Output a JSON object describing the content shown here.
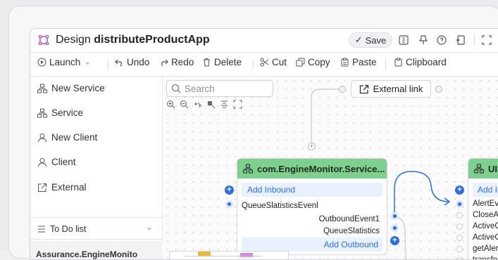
{
  "app": {
    "title_prefix": "Design",
    "title_name": "distributeProductApp",
    "save_label": "Save"
  },
  "toolbar": {
    "launch": "Launch",
    "undo": "Undo",
    "redo": "Redo",
    "delete": "Delete",
    "cut": "Cut",
    "copy": "Copy",
    "paste": "Paste",
    "clipboard": "Clipboard"
  },
  "sidebar": {
    "items": [
      {
        "label": "New Service",
        "icon": "service-icon"
      },
      {
        "label": "Service",
        "icon": "service-icon"
      },
      {
        "label": "New Client",
        "icon": "user-icon"
      },
      {
        "label": "Client",
        "icon": "user-icon"
      },
      {
        "label": "External",
        "icon": "external-icon"
      }
    ],
    "todo_label": "To Do list",
    "todo_first": "Assurance.EngineMonito"
  },
  "canvas": {
    "search_placeholder": "Search",
    "external_link": "External link",
    "node1": {
      "title": "com.EngineMonitor.Service...",
      "add_inbound": "Add Inbound",
      "inbound_events": [
        "QueueSlatisticsEvenl"
      ],
      "outbound_events": [
        "OutboundEvent1",
        "QueueSlatistics"
      ],
      "add_outbound": "Add Outbound"
    },
    "node2": {
      "title": "UIServic",
      "add_inbound": "Add Inbound",
      "events": [
        "AlertEvent",
        "CloseAlert",
        "ActiveCollabs",
        "ActiveCollabs",
        "getAlertCoun",
        "transformAler"
      ]
    }
  },
  "colors": {
    "accent": "#2f6fe0",
    "node_header": "#7fcf8f",
    "app_icon": "#c04bd0"
  }
}
